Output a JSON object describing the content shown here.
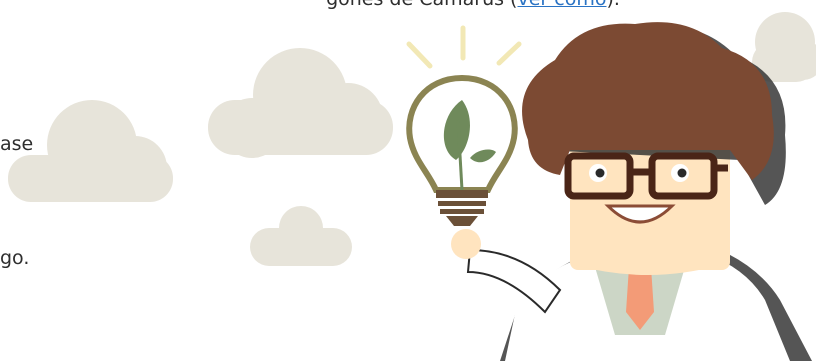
{
  "header_line": {
    "text_before": "gones de Camarus (",
    "link_text": "ver cómo",
    "text_after": ")."
  },
  "fragments": {
    "line1": "ase",
    "line2": "go."
  },
  "colors": {
    "cloud": "#e7e4da",
    "hair": "#7c4a33",
    "skin": "#ffe4bf",
    "glasses": "#4a2517",
    "coat": "#ffffff",
    "shadow": "#2a2a2a",
    "shirt": "#ccd6c6",
    "tie": "#f39b77",
    "bulb_outline": "#8b8452",
    "leaf": "#6f8a5b",
    "bulb_base": "#6b5038",
    "rays": "#f2e8b5",
    "link": "#2a73c4"
  },
  "icons": [
    "lightbulb-leaf-icon",
    "cloud-icon",
    "scientist-illustration"
  ]
}
